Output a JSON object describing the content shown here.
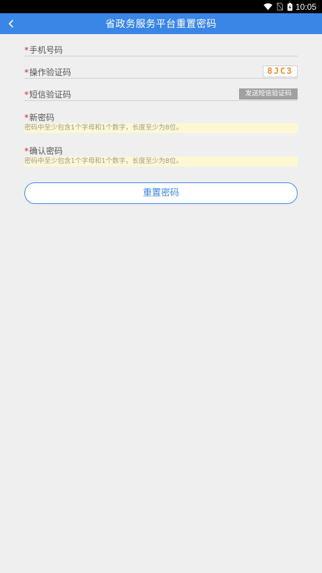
{
  "status_bar": {
    "time": "10:05",
    "icons": [
      "wifi-icon",
      "no-sim-icon",
      "battery-charging-icon"
    ]
  },
  "app_bar": {
    "back_icon": "chevron-left-icon",
    "title": "省政务服务平台重置密码"
  },
  "colors": {
    "accent": "#3a86e6",
    "required": "#e02020",
    "captcha": "#f0892a",
    "hint_bg": "#fdf8d2"
  },
  "form": {
    "required_mark": "*",
    "phone": {
      "label": "手机号码"
    },
    "captcha": {
      "label": "操作验证码",
      "code": "8JC3"
    },
    "sms": {
      "label": "短信验证码",
      "button": "发送短信验证码"
    },
    "new_password": {
      "label": "新密码",
      "hint": "密码中至少包含1个字母和1个数字，长度至少为8位。"
    },
    "confirm_password": {
      "label": "确认密码",
      "hint": "密码中至少包含1个字母和1个数字，长度至少为8位。"
    },
    "submit": "重置密码"
  }
}
